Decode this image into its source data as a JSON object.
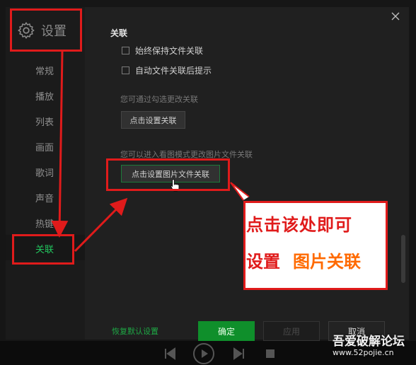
{
  "sidebar": {
    "title": "设置",
    "items": [
      "常规",
      "播放",
      "列表",
      "画面",
      "歌词",
      "声音",
      "热键",
      "关联"
    ],
    "active_index": 7
  },
  "content": {
    "section_title": "关联",
    "checkboxes": [
      {
        "label": "始终保持文件关联",
        "checked": false
      },
      {
        "label": "自动文件关联后提示",
        "checked": false
      }
    ],
    "hint1": "您可通过勾选更改关联",
    "button_set_assoc": "点击设置关联",
    "hint2": "您可以进入看图模式更改图片文件关联",
    "button_set_image_assoc": "点击设置图片文件关联"
  },
  "footer": {
    "restore": "恢复默认设置",
    "ok": "确定",
    "apply": "应用",
    "cancel": "取消"
  },
  "annotation": {
    "line1": "点击该处即可",
    "line2a": "设置",
    "line2b": "图片关联",
    "color_red": "#e01b1b",
    "color_orange": "#ff6a00"
  },
  "watermark": {
    "site_name": "吾爱破解论坛",
    "url": "www.52pojie.cn"
  },
  "colors": {
    "accent_green": "#22c55e",
    "ok_button": "#0f8f2b"
  }
}
